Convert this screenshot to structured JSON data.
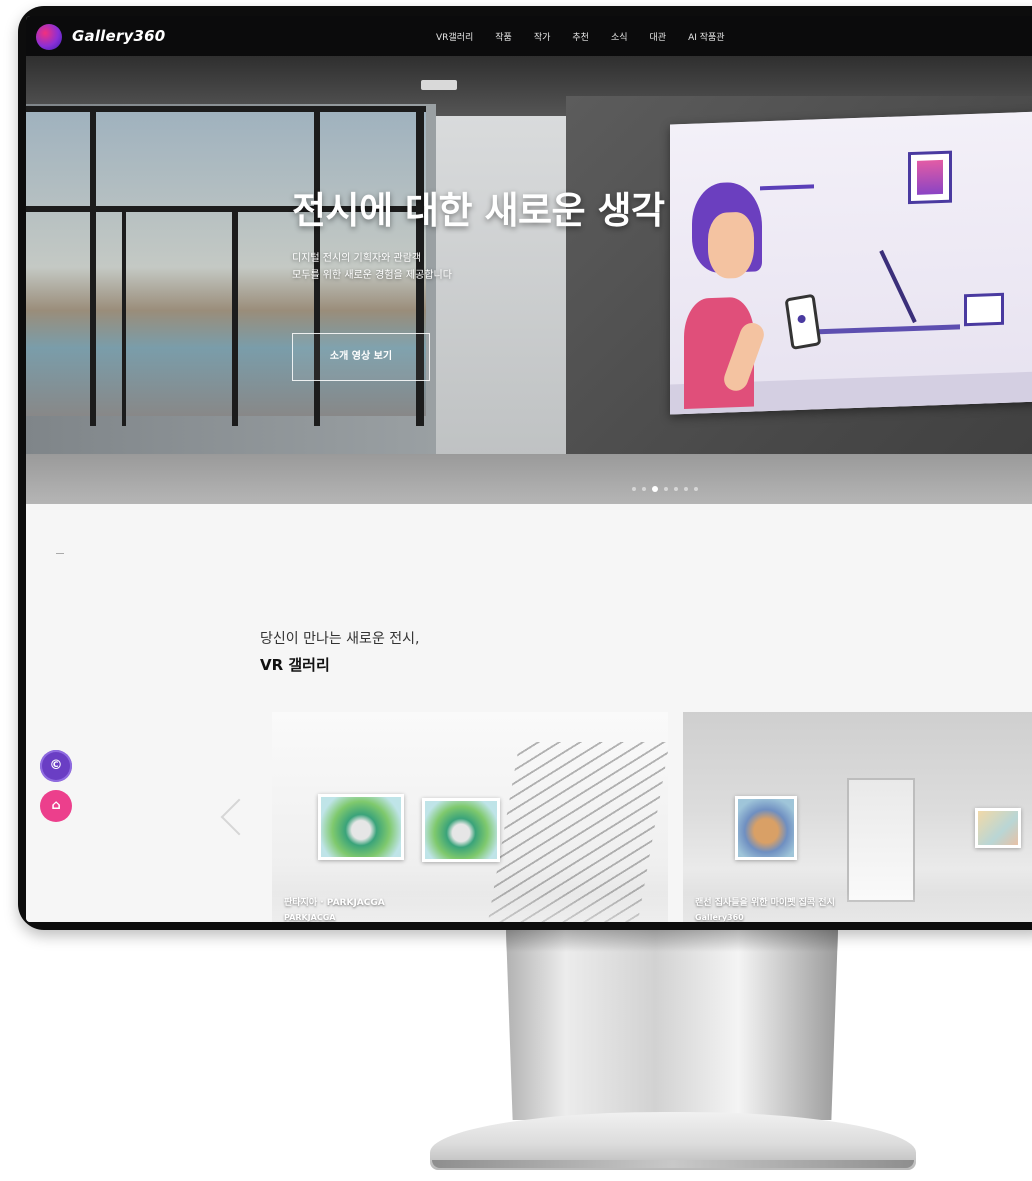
{
  "brand": {
    "name": "Gallery360"
  },
  "nav": {
    "items": [
      {
        "label": "VR갤러리"
      },
      {
        "label": "작품"
      },
      {
        "label": "작가"
      },
      {
        "label": "추천"
      },
      {
        "label": "소식"
      },
      {
        "label": "대관"
      },
      {
        "label": "AI 작품관"
      }
    ]
  },
  "hero": {
    "title": "전시에 대한 새로운 생각",
    "subtitle_line1": "디지털 전시의 기획자와 관람객",
    "subtitle_line2": "모두를 위한 새로운 경험을 제공합니다",
    "button_label": "소개 영상 보기",
    "slide_count": 7,
    "active_slide_index": 2
  },
  "section": {
    "kicker": "당신이 만나는 새로운 전시,",
    "title": "VR 갤러리"
  },
  "cards": [
    {
      "title": "판타지아 · PARKJACGA",
      "subtitle": "PARKJACGA"
    },
    {
      "title": "랜선 집사들을 위한 마이펫 집콕 전시",
      "subtitle": "Gallery360"
    }
  ],
  "floating_buttons": {
    "first_icon": "©",
    "second_icon": "⌂"
  },
  "colors": {
    "nav_bg": "#0b0b0c",
    "accent_purple": "#6a3ec4",
    "accent_pink": "#ec3f8c"
  },
  "icons": {
    "logo": "logo-circle-icon",
    "prev_arrow": "chevron-left-icon",
    "float_top": "copyright-icon",
    "float_bottom": "home-icon"
  }
}
